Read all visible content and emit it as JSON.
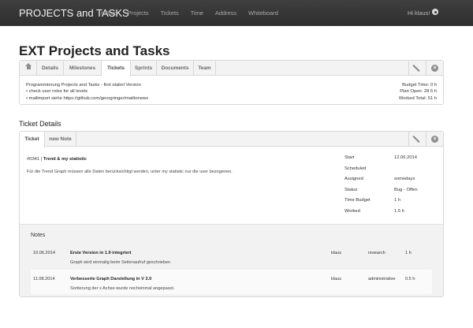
{
  "navbar": {
    "brand": "PROJECTS and TASKS",
    "links": [
      "InBox",
      "Projects",
      "Tickets",
      "Time",
      "Address",
      "Whiteboard"
    ],
    "greeting": "Hi klaus!"
  },
  "page": {
    "title": "EXT Projects and Tasks"
  },
  "project_tabs": [
    "Details",
    "Milestones",
    "Tickets",
    "Sprints",
    "Documents",
    "Team"
  ],
  "project_tabs_active": "Tickets",
  "project_info": {
    "line1": "Programmierung Projects and Tasks - first stabel Version",
    "line2": "• check user roles for all levels",
    "line3": "• mailimport siehe https://github.com/georgringer/mailtonews",
    "budget_time": "Budget Time: 0 h",
    "plan_open": "Plan Open: 28.5 h",
    "worked_total": "Worked Total: 51 h"
  },
  "ticket_details": {
    "heading": "Ticket Details",
    "tabs": [
      "Ticket",
      "new Note"
    ],
    "active_tab": "Ticket",
    "ticket_number": "#0341 |",
    "ticket_title": "Trend & my statistic",
    "description": "Für die Trend Graph müssen alle Daten berücksichtigt werden, unter my statistic nur die user bezogenen.",
    "properties": [
      {
        "label": "Start",
        "value": "12.06.2014"
      },
      {
        "label": "Scheduled",
        "value": ""
      },
      {
        "label": "Assigned",
        "value": "somedays"
      },
      {
        "label": "Status",
        "value": "Bug - Offen"
      },
      {
        "label": "Time Budget",
        "value": "1 h"
      },
      {
        "label": "Worked",
        "value": "1.5 h"
      }
    ]
  },
  "notes": {
    "title": "Notes",
    "items": [
      {
        "date": "10.06.2014",
        "title": "Erste Version in 1.9 integriert",
        "body": "Graph wird einmalig beim Seitenaufruf geschrieben",
        "user": "klaus",
        "category": "research",
        "time": "1 h"
      },
      {
        "date": "11.08.2014",
        "title": "Verbesserte Graph Darstellung in V 2.0",
        "body": "Sortierung der x Achse wurde nocheinmal angepasst.",
        "user": "klaus",
        "category": "administrative",
        "time": "0.5 h"
      }
    ]
  }
}
